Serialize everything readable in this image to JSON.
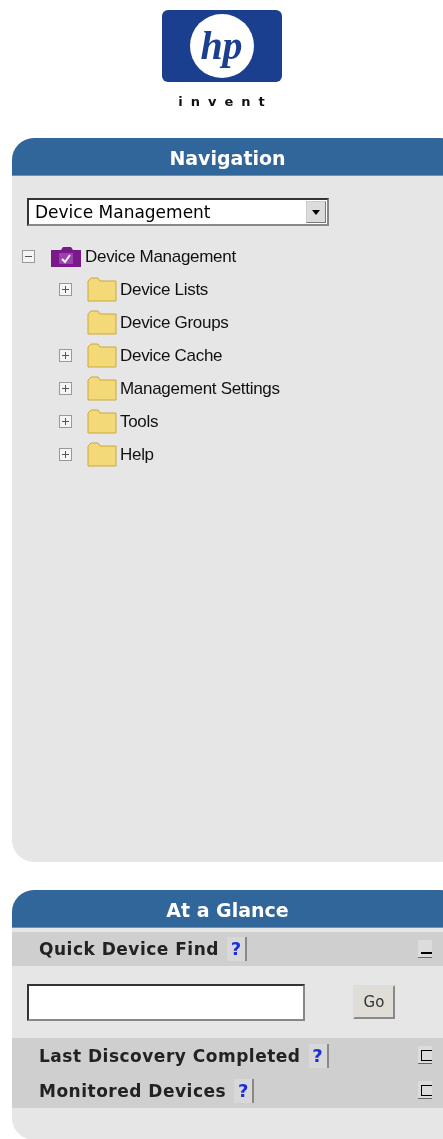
{
  "logo": {
    "mark": "hp",
    "tagline": "invent"
  },
  "navigation": {
    "title": "Navigation",
    "select": {
      "value": "Device Management"
    },
    "tree": [
      {
        "label": "Device Management",
        "expanded": true,
        "children": [
          {
            "label": "Device Lists",
            "expandable": true
          },
          {
            "label": "Device Groups",
            "expandable": false
          },
          {
            "label": "Device Cache",
            "expandable": true
          },
          {
            "label": "Management Settings",
            "expandable": true
          },
          {
            "label": "Tools",
            "expandable": true
          },
          {
            "label": "Help",
            "expandable": true
          }
        ]
      }
    ]
  },
  "at_a_glance": {
    "title": "At a Glance",
    "sections": [
      {
        "title": "Quick Device Find",
        "help": "?",
        "expanded": true,
        "button": "Go"
      },
      {
        "title": "Last Discovery Completed",
        "help": "?",
        "expanded": false
      },
      {
        "title": "Monitored Devices",
        "help": "?",
        "expanded": false
      }
    ]
  }
}
